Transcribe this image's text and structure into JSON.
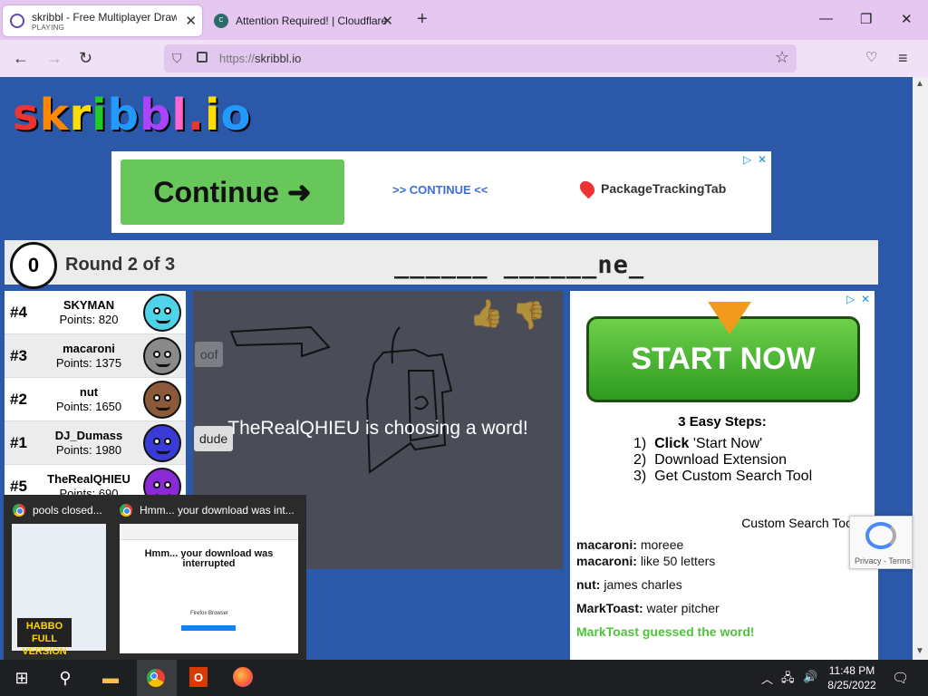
{
  "browser": {
    "tabs": [
      {
        "title": "skribbl - Free Multiplayer Drawi",
        "subtitle": "PLAYING"
      },
      {
        "title": "Attention Required! | Cloudflare"
      }
    ],
    "url_scheme": "https://",
    "url_host": "skribbl.io"
  },
  "page": {
    "logo": {
      "chars": [
        "s",
        "k",
        "r",
        "i",
        "b",
        "b",
        "l",
        ".",
        "i",
        "o"
      ]
    },
    "ad_top": {
      "button": "Continue",
      "link": ">> CONTINUE <<",
      "brand": "PackageTrackingTab"
    },
    "game": {
      "timer": "0",
      "round": "Round 2 of 3",
      "word": "______ ______ne_",
      "status": "TheRealQHIEU is choosing a word!"
    },
    "players": [
      {
        "rank": "#4",
        "name": "SKYMAN",
        "points": "Points: 820",
        "color": "#4fd3e8"
      },
      {
        "rank": "#3",
        "name": "macaroni",
        "points": "Points: 1375",
        "color": "#8a8a8a"
      },
      {
        "rank": "#2",
        "name": "nut",
        "points": "Points: 1650",
        "color": "#8a5a3a"
      },
      {
        "rank": "#1",
        "name": "DJ_Dumass",
        "points": "Points: 1980",
        "color": "#3a3ad6"
      },
      {
        "rank": "#5",
        "name": "TheRealQHIEU",
        "points": "Points: 690",
        "color": "#8a2ad6"
      }
    ],
    "bubbles": [
      "oof",
      "dude"
    ],
    "ad_right": {
      "button": "START NOW",
      "steps_title": "3 Easy Steps:",
      "steps": [
        {
          "num": "1)",
          "bold": "Click",
          "text": " 'Start Now'"
        },
        {
          "num": "2)",
          "bold": "",
          "text": "Download Extension"
        },
        {
          "num": "3)",
          "bold": "",
          "text": "Get Custom Search Tool"
        }
      ],
      "footer": "Custom Search Tool"
    },
    "chat": [
      {
        "user": "macaroni:",
        "text": "like 50 letters"
      },
      {
        "user": "nut:",
        "text": "james charles"
      },
      {
        "user": "MarkToast:",
        "text": "water pitcher"
      }
    ],
    "chat_partial": {
      "user": "macaroni:",
      "text": "moreee"
    },
    "chat_guess": "MarkToast guessed the word!",
    "recaptcha": "Privacy - Terms"
  },
  "preview": {
    "items": [
      {
        "title": "pools closed..."
      },
      {
        "title": "Hmm... your download was int..."
      }
    ],
    "thumb_habbo": "HABBO FULL VERSION",
    "thumb_title": "Hmm... your download was interrupted",
    "thumb_firefox": "Firefox Browser"
  },
  "taskbar": {
    "time": "11:48 PM",
    "date": "8/25/2022"
  },
  "colors": {
    "tab_strip": "#e6c7f2",
    "page_bg": "#2c58a9",
    "guess_green": "#4fc43a"
  }
}
